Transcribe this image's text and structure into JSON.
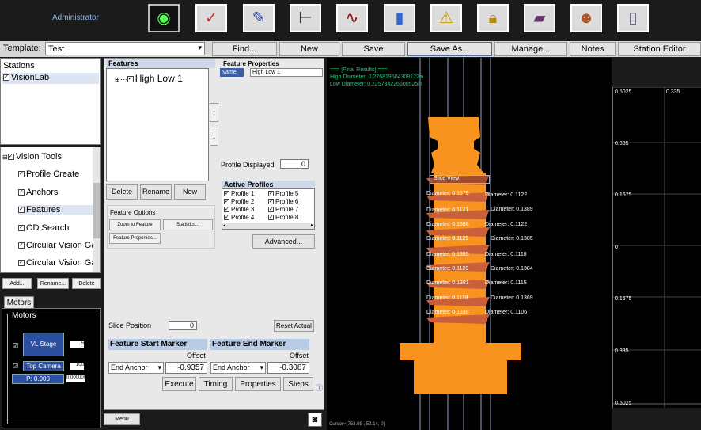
{
  "app": {
    "user": "Administrator"
  },
  "toolbar_icons": [
    "eye-logo-icon",
    "chart-report-icon",
    "notepad-icon",
    "caliper-icon",
    "waveform-icon",
    "bar-chart-icon",
    "warning-icon",
    "lock-icon",
    "book-icon",
    "users-icon",
    "document-icon"
  ],
  "row2": {
    "template_label": "Template:",
    "template_value": "Test",
    "find": "Find...",
    "new": "New",
    "save": "Save",
    "save_as": "Save As...",
    "manage": "Manage...",
    "notes": "Notes",
    "station_editor": "Station Editor"
  },
  "stations": {
    "title": "Stations",
    "items": [
      "VisionLab"
    ]
  },
  "tools": {
    "root": "Vision Tools",
    "items": [
      "Profile Create",
      "Anchors",
      "Features",
      "OD Search",
      "Circular Vision Ga",
      "Circular Vision Ga"
    ],
    "add": "Add...",
    "rename": "Rename...",
    "delete": "Delete"
  },
  "motors": {
    "tab": "Motors",
    "group": "Motors",
    "vl_stage": "VL Stage",
    "top_camera": "Top Camera",
    "p_label": "P: 0.000",
    "vl_value": "5",
    "tc_value": "100",
    "p_value": "0.000000"
  },
  "features": {
    "title": "Features",
    "item": "High Low 1",
    "delete": "Delete",
    "rename": "Rename",
    "new": "New",
    "options_title": "Feature Options",
    "zoom": "Zoom to Feature",
    "statistics": "Statistics...",
    "properties_btn": "Feature Properties..."
  },
  "feature_props": {
    "title": "Feature Properties",
    "name_label": "Name",
    "name_value": "High Low 1",
    "profile_displayed_label": "Profile Displayed",
    "profile_displayed_value": "0",
    "active_profiles_title": "Active Profiles",
    "profiles_col1": [
      "Profile 1",
      "Profile 2",
      "Profile 3",
      "Profile 4"
    ],
    "profiles_col2": [
      "Profile 5",
      "Profile 6",
      "Profile 7",
      "Profile 8"
    ],
    "advanced": "Advanced..."
  },
  "slice": {
    "label": "Slice Position",
    "value": "0",
    "reset": "Reset Actual"
  },
  "markers": {
    "start_title": "Feature Start Marker",
    "end_title": "Feature End Marker",
    "offset_label": "Offset",
    "start_anchor": "End Anchor",
    "start_offset": "-0.9357",
    "end_anchor": "End Anchor",
    "end_offset": "-0.3087"
  },
  "actions": {
    "execute": "Execute",
    "timing": "Timing",
    "properties": "Properties",
    "steps": "Steps",
    "menu": "Menu"
  },
  "results": {
    "line1": "=== [Final Results] ===",
    "line2": "High Diameter: 0.276819504308122in",
    "line3": "Low Diameter: 0.225734226600525in",
    "slice_view": "Slice View",
    "cursor": "Cursor=(753.05 , 52.14, 0)"
  },
  "diam_left": [
    "Diameter: 0.1378",
    "Diameter: 0.1121",
    "Diameter: 0.1386",
    "Diameter: 0.1125",
    "Diameter: 0.1385",
    "Diameter: 0.1123",
    "Diameter: 0.1381",
    "Diameter: 0.1118",
    "Diameter: 0.1338"
  ],
  "diam_right": [
    "Diameter: 0.1122",
    "Diameter: 0.1389",
    "Diameter: 0.1122",
    "Diameter: 0.1385",
    "Diameter: 0.1118",
    "Diameter: 0.1384",
    "Diameter: 0.1115",
    "Diameter: 0.1369",
    "Diameter: 0.1106"
  ],
  "axis": {
    "top_left": "0.5025",
    "top_right": "0.335",
    "ticks": [
      "0.335",
      "0.1675",
      "0",
      "0.1675",
      "0.335",
      "0.5025"
    ]
  },
  "colors": {
    "part": "#f7931e",
    "background": "#000000",
    "panel": "#e8e8e8"
  }
}
